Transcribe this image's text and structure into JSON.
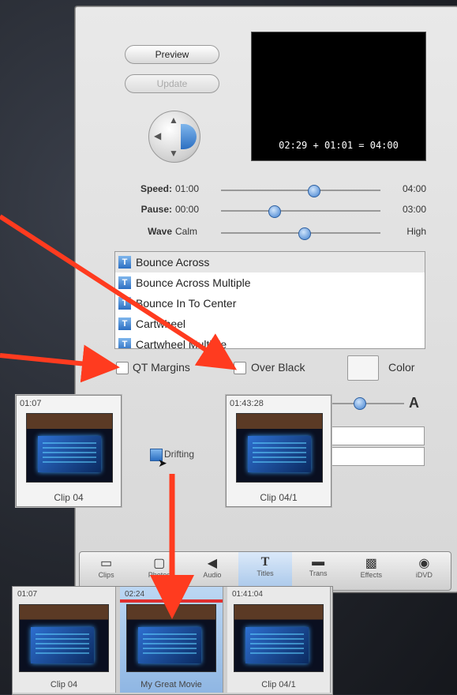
{
  "panel": {
    "preview_label": "Preview",
    "update_label": "Update",
    "preview_timecode": "02:29 + 01:01 = 04:00"
  },
  "sliders": [
    {
      "label": "Speed:",
      "min": "01:00",
      "max": "04:00",
      "value": 0.58
    },
    {
      "label": "Pause:",
      "min": "00:00",
      "max": "03:00",
      "value": 0.33
    },
    {
      "label": "Wave",
      "min": "Calm",
      "max": "High",
      "value": 0.52
    }
  ],
  "title_list": [
    {
      "label": "Bounce Across",
      "selected": true
    },
    {
      "label": "Bounce Across Multiple",
      "selected": false
    },
    {
      "label": "Bounce In To Center",
      "selected": false
    },
    {
      "label": "Cartwheel",
      "selected": false
    },
    {
      "label": "Cartwheel Multiple",
      "selected": false
    }
  ],
  "options": {
    "qt_margins": "QT Margins",
    "over_black": "Over Black",
    "color": "Color",
    "font_size_glyph": "A"
  },
  "clips_drag": [
    {
      "timecode": "01:07",
      "name": "Clip 04"
    },
    {
      "timecode": "01:43:28",
      "name": "Clip 04/1"
    }
  ],
  "drift_label": "Drifting",
  "toolbar": [
    {
      "label": "Clips",
      "icon": "clips-icon",
      "glyph": "▭"
    },
    {
      "label": "Photos",
      "icon": "photos-icon",
      "glyph": "▢"
    },
    {
      "label": "Audio",
      "icon": "audio-icon",
      "glyph": "◀"
    },
    {
      "label": "Titles",
      "icon": "titles-icon",
      "glyph": "T",
      "active": true
    },
    {
      "label": "Trans",
      "icon": "transitions-icon",
      "glyph": "▬"
    },
    {
      "label": "Effects",
      "icon": "effects-icon",
      "glyph": "▩"
    },
    {
      "label": "iDVD",
      "icon": "idvd-icon",
      "glyph": "◉"
    }
  ],
  "timeline": [
    {
      "timecode": "01:07",
      "name": "Clip 04"
    },
    {
      "timecode": "02:24",
      "name": "My Great Movie",
      "selected": true
    },
    {
      "timecode": "01:41:04",
      "name": "Clip 04/1"
    }
  ],
  "colors": {
    "annotation_arrow": "#ff3b1f",
    "selection_blue": "#2c6fc2"
  }
}
